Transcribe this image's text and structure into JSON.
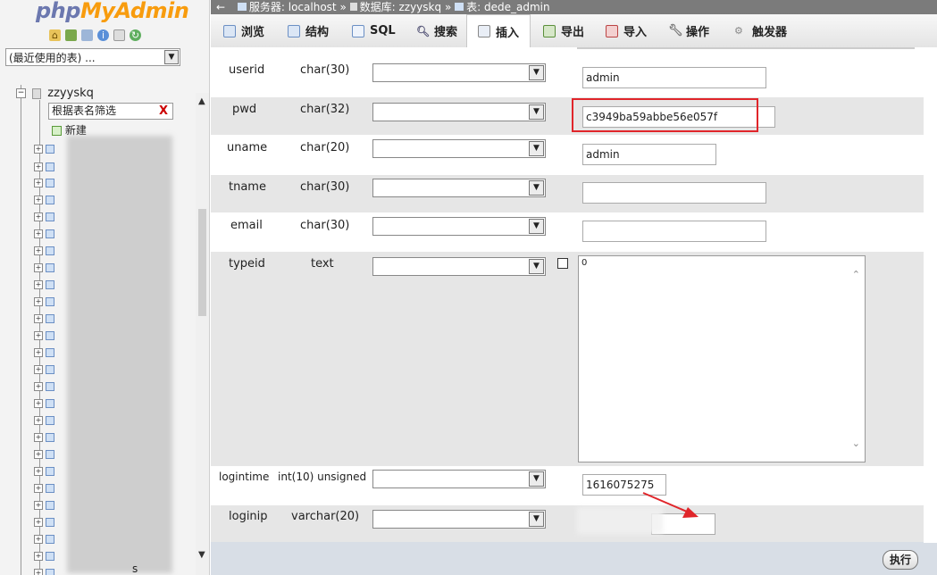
{
  "brand": {
    "php": "php",
    "myadmin": "MyAdmin"
  },
  "nav": {
    "icons": [
      "home-icon",
      "database-icon",
      "query-icon",
      "info-icon",
      "docs-icon",
      "settings-icon"
    ],
    "recent_tables": "(最近使用的表) ...",
    "database": "zzyyskq",
    "filter_placeholder": "根据表名筛选",
    "filter_clear": "X",
    "new_label": "新建",
    "stray_label": "s"
  },
  "breadcrumb": {
    "server": "服务器: localhost",
    "database": "数据库: zzyyskq",
    "table": "表: dede_admin",
    "separator": "»",
    "back": "←"
  },
  "tabs": [
    {
      "label": "浏览",
      "icon": "browse-icon"
    },
    {
      "label": "结构",
      "icon": "structure-icon"
    },
    {
      "label": "SQL",
      "icon": "sql-icon"
    },
    {
      "label": "搜索",
      "icon": "search-icon"
    },
    {
      "label": "插入",
      "icon": "insert-icon"
    },
    {
      "label": "导出",
      "icon": "export-icon"
    },
    {
      "label": "导入",
      "icon": "import-icon"
    },
    {
      "label": "操作",
      "icon": "wrench-icon"
    },
    {
      "label": "触发器",
      "icon": "trigger-icon"
    }
  ],
  "fields": [
    {
      "name": "userid",
      "type": "char(30)",
      "value": "admin"
    },
    {
      "name": "pwd",
      "type": "char(32)",
      "value": "c3949ba59abbe56e057f"
    },
    {
      "name": "uname",
      "type": "char(20)",
      "value": "admin"
    },
    {
      "name": "tname",
      "type": "char(30)",
      "value": ""
    },
    {
      "name": "email",
      "type": "char(30)",
      "value": ""
    },
    {
      "name": "typeid",
      "type": "text",
      "value": "0"
    },
    {
      "name": "logintime",
      "type": "int(10) unsigned",
      "value": "1616075275"
    },
    {
      "name": "loginip",
      "type": "varchar(20)",
      "value": ""
    }
  ],
  "actions": {
    "execute": "执行"
  },
  "colors": {
    "highlight": "#e0252a",
    "topbar": "#7b7b7b",
    "php_blue": "#6c78af",
    "myadmin_orange": "#f89c0e"
  }
}
